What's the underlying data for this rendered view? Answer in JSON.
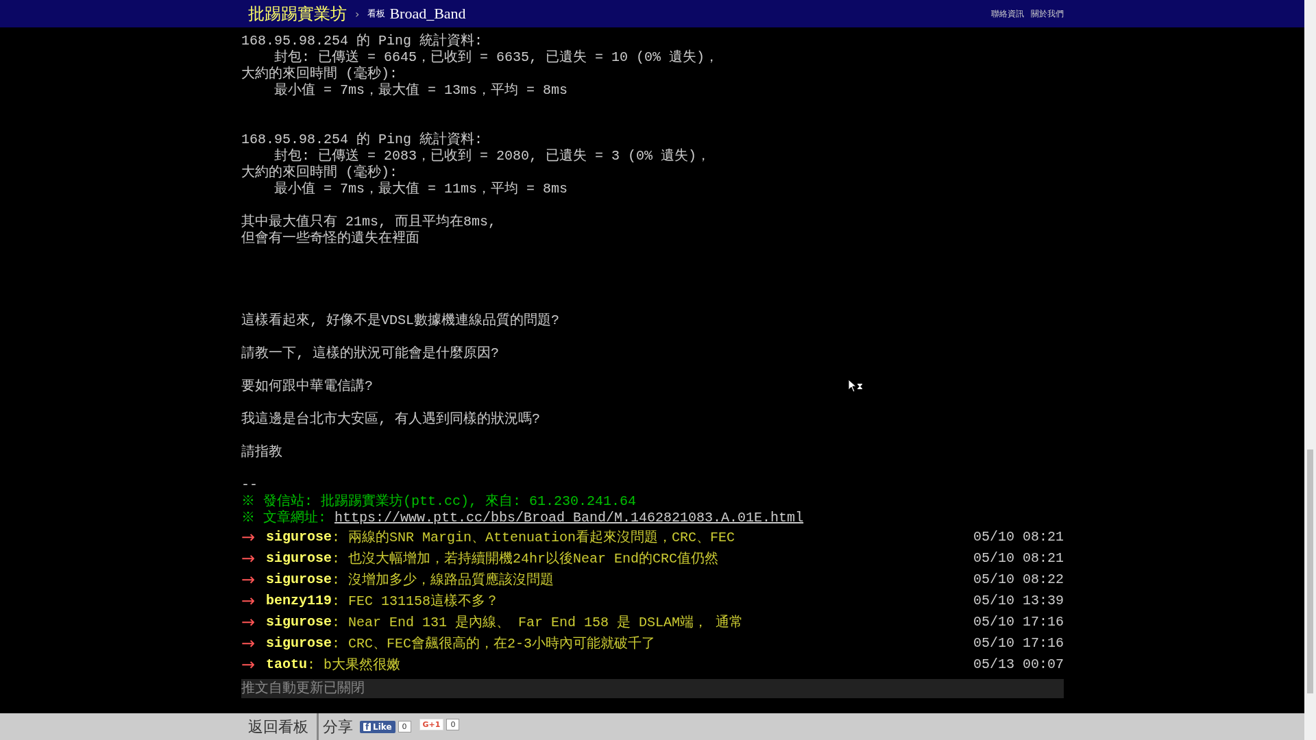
{
  "header": {
    "site_title": "批踢踢實業坊",
    "separator": "›",
    "board_label": "看板",
    "board_name": "Broad_Band",
    "links": [
      "聯絡資訊",
      "關於我們"
    ]
  },
  "body": [
    {
      "lines": [
        "168.95.98.254 的 Ping 統計資料:",
        "    封包: 已傳送 = 6645，已收到 = 6635, 已遺失 = 10 (0% 遺失)，",
        "大約的來回時間 (毫秒):",
        "    最小值 = 7ms，最大值 = 13ms，平均 = 8ms"
      ]
    },
    {
      "lines": [
        "168.95.98.254 的 Ping 統計資料:",
        "    封包: 已傳送 = 2083，已收到 = 2080, 已遺失 = 3 (0% 遺失)，",
        "大約的來回時間 (毫秒):",
        "    最小值 = 7ms，最大值 = 11ms，平均 = 8ms"
      ]
    },
    {
      "lines": [
        "其中最大值只有 21ms, 而且平均在8ms,",
        "但會有一些奇怪的遺失在裡面"
      ]
    },
    {
      "lines": [
        "這樣看起來, 好像不是VDSL數據機連線品質的問題?"
      ]
    },
    {
      "lines": [
        "請教一下, 這樣的狀況可能會是什麼原因?"
      ]
    },
    {
      "lines": [
        "要如何跟中華電信講?"
      ]
    },
    {
      "lines": [
        "我這邊是台北市大安區, 有人遇到同樣的狀況嗎?"
      ]
    },
    {
      "lines": [
        "請指教"
      ]
    },
    {
      "lines": [
        "--"
      ]
    }
  ],
  "signature": {
    "source": "※ 發信站: 批踢踢實業坊(ptt.cc), 來自: 61.230.241.64",
    "url_label": "※ 文章網址: ",
    "url": "https://www.ptt.cc/bbs/Broad_Band/M.1462821083.A.01E.html"
  },
  "pushes": [
    {
      "tag": "→",
      "user": "sigurose",
      "content": ": 兩線的SNR Margin、Attenuation看起來沒問題，CRC、FEC",
      "time": "05/10 08:21"
    },
    {
      "tag": "→",
      "user": "sigurose",
      "content": ": 也沒大幅增加，若持續開機24hr以後Near End的CRC值仍然",
      "time": "05/10 08:21"
    },
    {
      "tag": "→",
      "user": "sigurose",
      "content": ": 沒增加多少，線路品質應該沒問題",
      "time": "05/10 08:22"
    },
    {
      "tag": "→",
      "user": "benzy119",
      "content": ": FEC 131158這樣不多？",
      "time": "05/10 13:39"
    },
    {
      "tag": "→",
      "user": "sigurose",
      "content": ": Near End 131 是內線、 Far End 158 是 DSLAM端， 通常",
      "time": "05/10 17:16"
    },
    {
      "tag": "→",
      "user": "sigurose",
      "content": ": CRC、FEC會飆很高的，在2-3小時內可能就破千了",
      "time": "05/10 17:16"
    },
    {
      "tag": "→",
      "user": "taotu",
      "content": ": b大果然很嫩",
      "time": "05/13 00:07"
    }
  ],
  "auto_update_notice": "推文自動更新已關閉",
  "footer": {
    "back_button": "返回看板",
    "share_label": "分享",
    "facebook": {
      "icon": "f",
      "label": "Like",
      "count": "0"
    },
    "google_plus": {
      "label": "G+1",
      "count": "0"
    }
  }
}
